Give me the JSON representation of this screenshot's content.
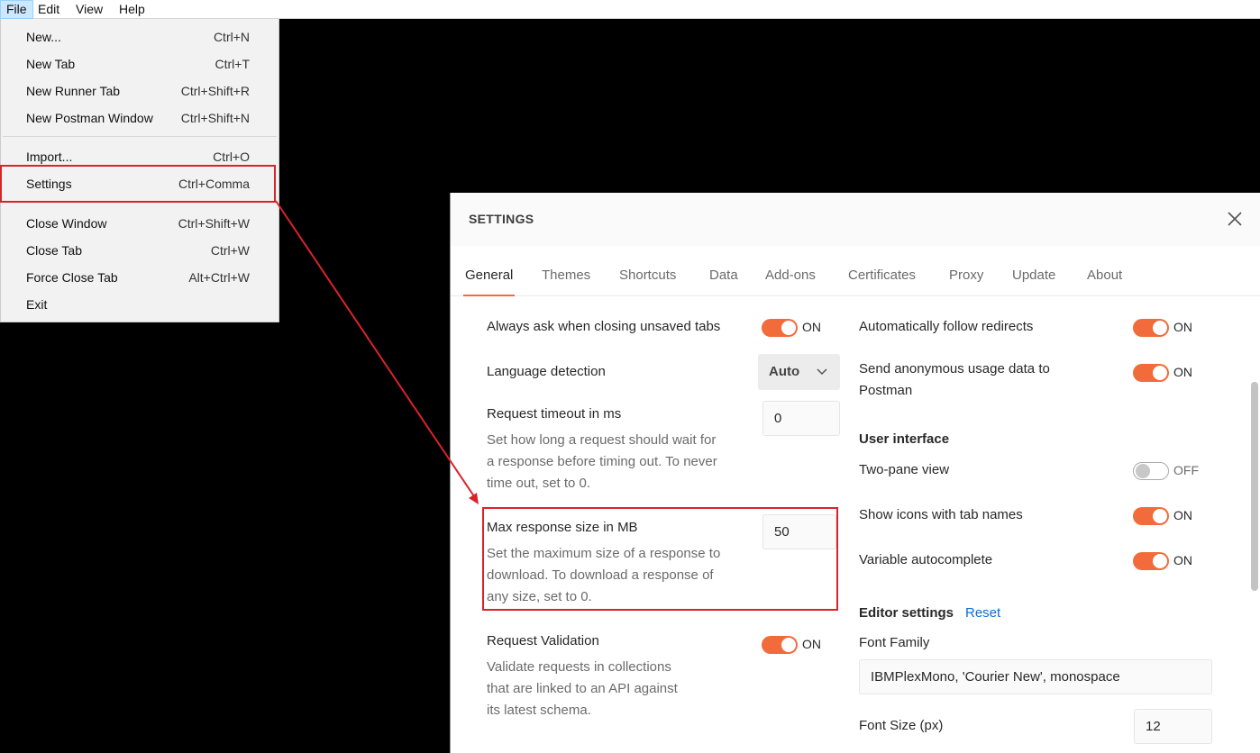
{
  "menubar": {
    "items": [
      "File",
      "Edit",
      "View",
      "Help"
    ]
  },
  "file_menu": {
    "items": [
      {
        "label": "New...",
        "shortcut": "Ctrl+N"
      },
      {
        "label": "New Tab",
        "shortcut": "Ctrl+T"
      },
      {
        "label": "New Runner Tab",
        "shortcut": "Ctrl+Shift+R"
      },
      {
        "label": "New Postman Window",
        "shortcut": "Ctrl+Shift+N"
      },
      {
        "label": "Import...",
        "shortcut": "Ctrl+O"
      },
      {
        "label": "Settings",
        "shortcut": "Ctrl+Comma"
      },
      {
        "label": "Close Window",
        "shortcut": "Ctrl+Shift+W"
      },
      {
        "label": "Close Tab",
        "shortcut": "Ctrl+W"
      },
      {
        "label": "Force Close Tab",
        "shortcut": "Alt+Ctrl+W"
      },
      {
        "label": "Exit",
        "shortcut": ""
      }
    ]
  },
  "settings": {
    "title": "SETTINGS",
    "tabs": [
      "General",
      "Themes",
      "Shortcuts",
      "Data",
      "Add-ons",
      "Certificates",
      "Proxy",
      "Update",
      "About"
    ],
    "active_tab": "General",
    "left": {
      "always_ask": {
        "label": "Always ask when closing unsaved tabs",
        "state": "ON"
      },
      "language_detection": {
        "label": "Language detection",
        "value": "Auto"
      },
      "request_timeout": {
        "label": "Request timeout in ms",
        "desc1": "Set how long a request should wait for",
        "desc2": "a response before timing out. To never",
        "desc3": "time out, set to 0.",
        "value": "0"
      },
      "max_response": {
        "label": "Max response size in MB",
        "desc1": "Set the maximum size of a response to",
        "desc2": "download. To download a response of",
        "desc3": "any size, set to 0.",
        "value": "50"
      },
      "request_validation": {
        "label": "Request Validation",
        "state": "ON",
        "desc1": "Validate requests in collections",
        "desc2": "that are linked to an API against",
        "desc3": "its latest schema."
      }
    },
    "right": {
      "follow_redirects": {
        "label": "Automatically follow redirects",
        "state": "ON"
      },
      "usage_data": {
        "label1": "Send anonymous usage data to",
        "label2": "Postman",
        "state": "ON"
      },
      "ui_heading": "User interface",
      "two_pane": {
        "label": "Two-pane view",
        "state": "OFF"
      },
      "show_icons": {
        "label": "Show icons with tab names",
        "state": "ON"
      },
      "variable_autocomplete": {
        "label": "Variable autocomplete",
        "state": "ON"
      },
      "editor_heading": "Editor settings",
      "reset_link": "Reset",
      "font_family": {
        "label": "Font Family",
        "value": "IBMPlexMono, 'Courier New', monospace"
      },
      "font_size": {
        "label": "Font Size (px)",
        "value": "12"
      }
    }
  },
  "colors": {
    "accent": "#f26b3a",
    "annotation": "#d9232b",
    "link": "#0a6dd9"
  }
}
